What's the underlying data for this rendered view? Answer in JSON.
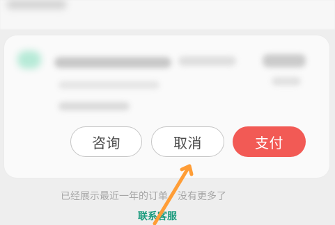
{
  "actions": {
    "consult_label": "咨询",
    "cancel_label": "取消",
    "pay_label": "支付"
  },
  "footer": {
    "notice": "已经展示最近一年的订单，没有更多了",
    "customer_service": "联系客服"
  },
  "colors": {
    "pay_button": "#f25a55",
    "link": "#1c9b7e",
    "arrow": "#ff9d36"
  }
}
